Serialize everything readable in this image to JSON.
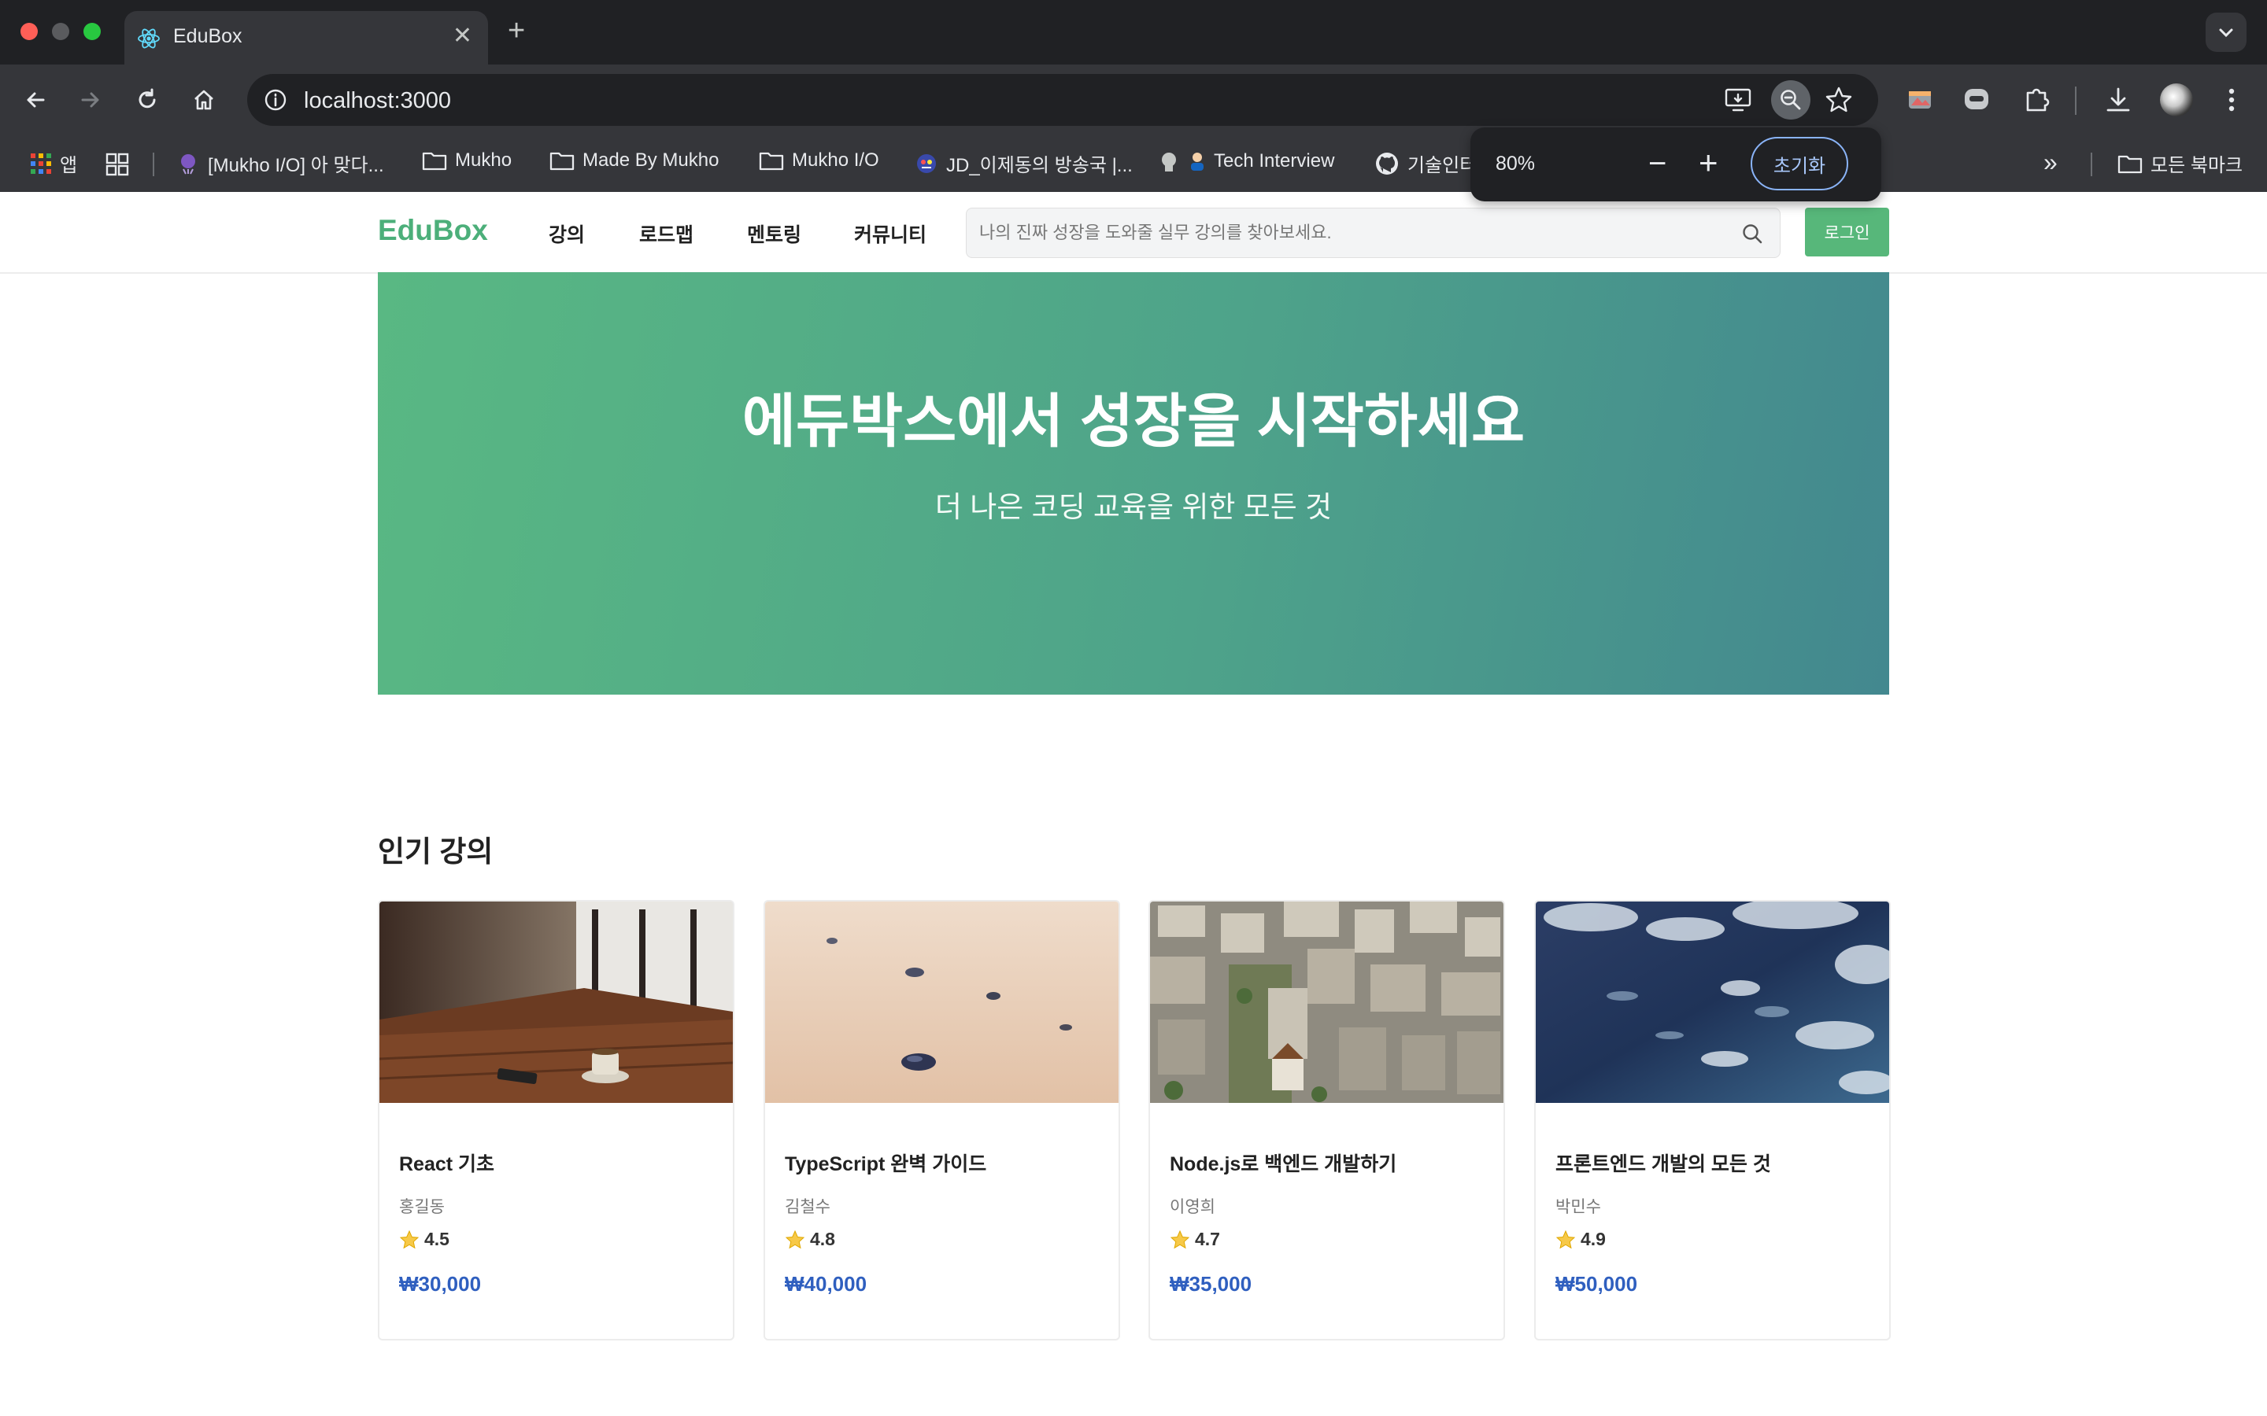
{
  "browser": {
    "tab_title": "EduBox",
    "tab_close": "✕",
    "new_tab": "+",
    "url": "localhost:3000",
    "bookmarks": [
      {
        "label": "앱",
        "icon": "apps-grid-icon"
      },
      {
        "label": "[Mukho I/O] 아 맞다...",
        "icon": "site-favicon-icon"
      },
      {
        "label": "Mukho",
        "icon": "folder-icon"
      },
      {
        "label": "Made By Mukho",
        "icon": "folder-icon"
      },
      {
        "label": "Mukho I/O",
        "icon": "folder-icon"
      },
      {
        "label": "JD_이제동의 방송국 |...",
        "icon": "site-favicon-icon"
      },
      {
        "label": "Tech Interview",
        "icon": "site-favicon-icon"
      },
      {
        "label": "기술인터",
        "icon": "github-icon"
      }
    ],
    "all_bookmarks": "모든 북마크",
    "more_bookmarks": "»",
    "zoom": {
      "level": "80%",
      "minus": "−",
      "plus": "+",
      "reset": "초기화"
    }
  },
  "site": {
    "logo": "EduBox",
    "nav": [
      "강의",
      "로드맵",
      "멘토링",
      "커뮤니티"
    ],
    "search_placeholder": "나의 진짜 성장을 도와줄 실무 강의를 찾아보세요.",
    "login": "로그인",
    "brand_color": "#57b77a",
    "price_color": "#2f5fbf"
  },
  "hero": {
    "title": "에듀박스에서 성장을 시작하세요",
    "subtitle": "더 나은 코딩 교육을 위한 모든 것"
  },
  "popular": {
    "title": "인기 강의",
    "courses": [
      {
        "title": "React 기초",
        "author": "홍길동",
        "rating": "4.5",
        "price": "₩30,000",
        "image": "cafe-table-photo"
      },
      {
        "title": "TypeScript 완벽 가이드",
        "author": "김철수",
        "rating": "4.8",
        "price": "₩40,000",
        "image": "sand-pebbles-photo"
      },
      {
        "title": "Node.js로 백엔드 개발하기",
        "author": "이영희",
        "rating": "4.7",
        "price": "₩35,000",
        "image": "city-aerial-photo"
      },
      {
        "title": "프론트엔드 개발의 모든 것",
        "author": "박민수",
        "rating": "4.9",
        "price": "₩50,000",
        "image": "blue-water-photo"
      }
    ]
  }
}
